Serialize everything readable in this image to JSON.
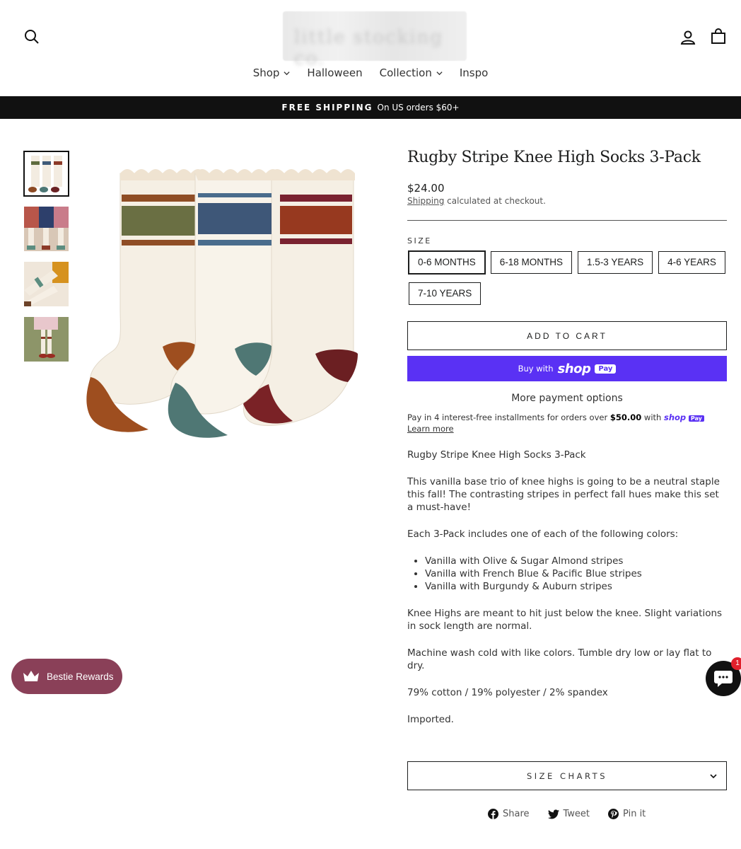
{
  "header": {
    "nav": [
      {
        "label": "Shop",
        "has_dropdown": true
      },
      {
        "label": "Halloween",
        "has_dropdown": false
      },
      {
        "label": "Collection",
        "has_dropdown": true
      },
      {
        "label": "Inspo",
        "has_dropdown": false
      }
    ],
    "icons": {
      "search": "search-icon",
      "account": "account-icon",
      "cart": "cart-icon"
    }
  },
  "promo": {
    "strong": "FREE SHIPPING",
    "text": "On US orders $60+"
  },
  "product": {
    "title": "Rugby Stripe Knee High Socks 3-Pack",
    "price": "$24.00",
    "shipping_link": "Shipping",
    "shipping_rest": " calculated at checkout.",
    "size_label": "SIZE",
    "sizes": [
      "0-6 MONTHS",
      "6-18 MONTHS",
      "1.5-3 YEARS",
      "4-6 YEARS",
      "7-10 YEARS"
    ],
    "selected_size": "0-6 MONTHS",
    "add_to_cart": "ADD TO CART",
    "buy_with": "Buy with",
    "shop_word": "shop",
    "pay_word": "Pay",
    "more_payment": "More payment options",
    "installments_pre": "Pay in 4 interest-free installments for orders over ",
    "installments_amount": "$50.00",
    "installments_with": " with ",
    "learn_more": "Learn more",
    "description": {
      "intro": "Rugby Stripe Knee High Socks 3-Pack",
      "para1": "This vanilla base trio of knee highs is going to be a neutral staple this fall! The contrasting stripes in perfect fall hues make this set a must-have!",
      "para2": "Each 3-Pack includes one of each of the following colors:",
      "colors": [
        "Vanilla with Olive & Sugar Almond stripes",
        "Vanilla with French Blue & Pacific Blue stripes",
        "Vanilla with Burgundy & Auburn stripes"
      ],
      "para3": "Knee Highs are meant to hit just below the knee. Slight variations in sock length are normal.",
      "para4": "Machine wash cold with like colors.  Tumble dry low or lay flat to dry.",
      "para5": "79% cotton / 19% polyester / 2% spandex",
      "para6": "Imported."
    },
    "size_charts": "SIZE CHARTS",
    "share": [
      {
        "label": "Share",
        "icon": "facebook-icon"
      },
      {
        "label": "Tweet",
        "icon": "twitter-icon"
      },
      {
        "label": "Pin it",
        "icon": "pinterest-icon"
      }
    ]
  },
  "rewards": {
    "label": "Bestie Rewards"
  },
  "chat": {
    "badge": "1"
  },
  "colors": {
    "shop_pay": "#5a31f4",
    "rewards": "#8a4058",
    "promo_bg": "#111111"
  }
}
